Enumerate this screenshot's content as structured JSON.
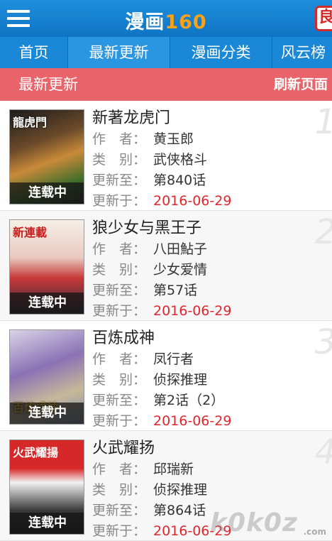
{
  "header": {
    "title_text": "漫画",
    "title_num": "160",
    "logo_char": "良"
  },
  "tabs": [
    {
      "label": "首页",
      "active": false
    },
    {
      "label": "最新更新",
      "active": true
    },
    {
      "label": "漫画分类",
      "active": false
    },
    {
      "label": "风云榜",
      "active": false
    }
  ],
  "section": {
    "title": "最新更新",
    "refresh_label": "刷新页面"
  },
  "labels": {
    "author": "作　者：",
    "category": "类　别：",
    "updated_to": "更新至：",
    "updated_on": "更新于："
  },
  "comics": [
    {
      "rank": "1",
      "title": "新著龙虎门",
      "author": "黄玉郎",
      "category": "武侠格斗",
      "latest": "第840话",
      "date": "2016-06-29",
      "status": "连载中",
      "cover_text": "龍虎門"
    },
    {
      "rank": "2",
      "title": "狼少女与黑王子",
      "author": "八田鮎子",
      "category": "少女爱情",
      "latest": "第57话",
      "date": "2016-06-29",
      "status": "连载中",
      "cover_text": "新連載"
    },
    {
      "rank": "3",
      "title": "百炼成神",
      "author": "凤行者",
      "category": "侦探推理",
      "latest": "第2话（2）",
      "date": "2016-06-29",
      "status": "连载中",
      "cover_text": "百炼成神"
    },
    {
      "rank": "4",
      "title": "火武耀扬",
      "author": "邱瑞新",
      "category": "侦探推理",
      "latest": "第864话",
      "date": "2016-06-29",
      "status": "连载中",
      "cover_text": "火武耀揚"
    }
  ],
  "watermark": {
    "text": "k0k0z",
    "sub": ".com"
  }
}
